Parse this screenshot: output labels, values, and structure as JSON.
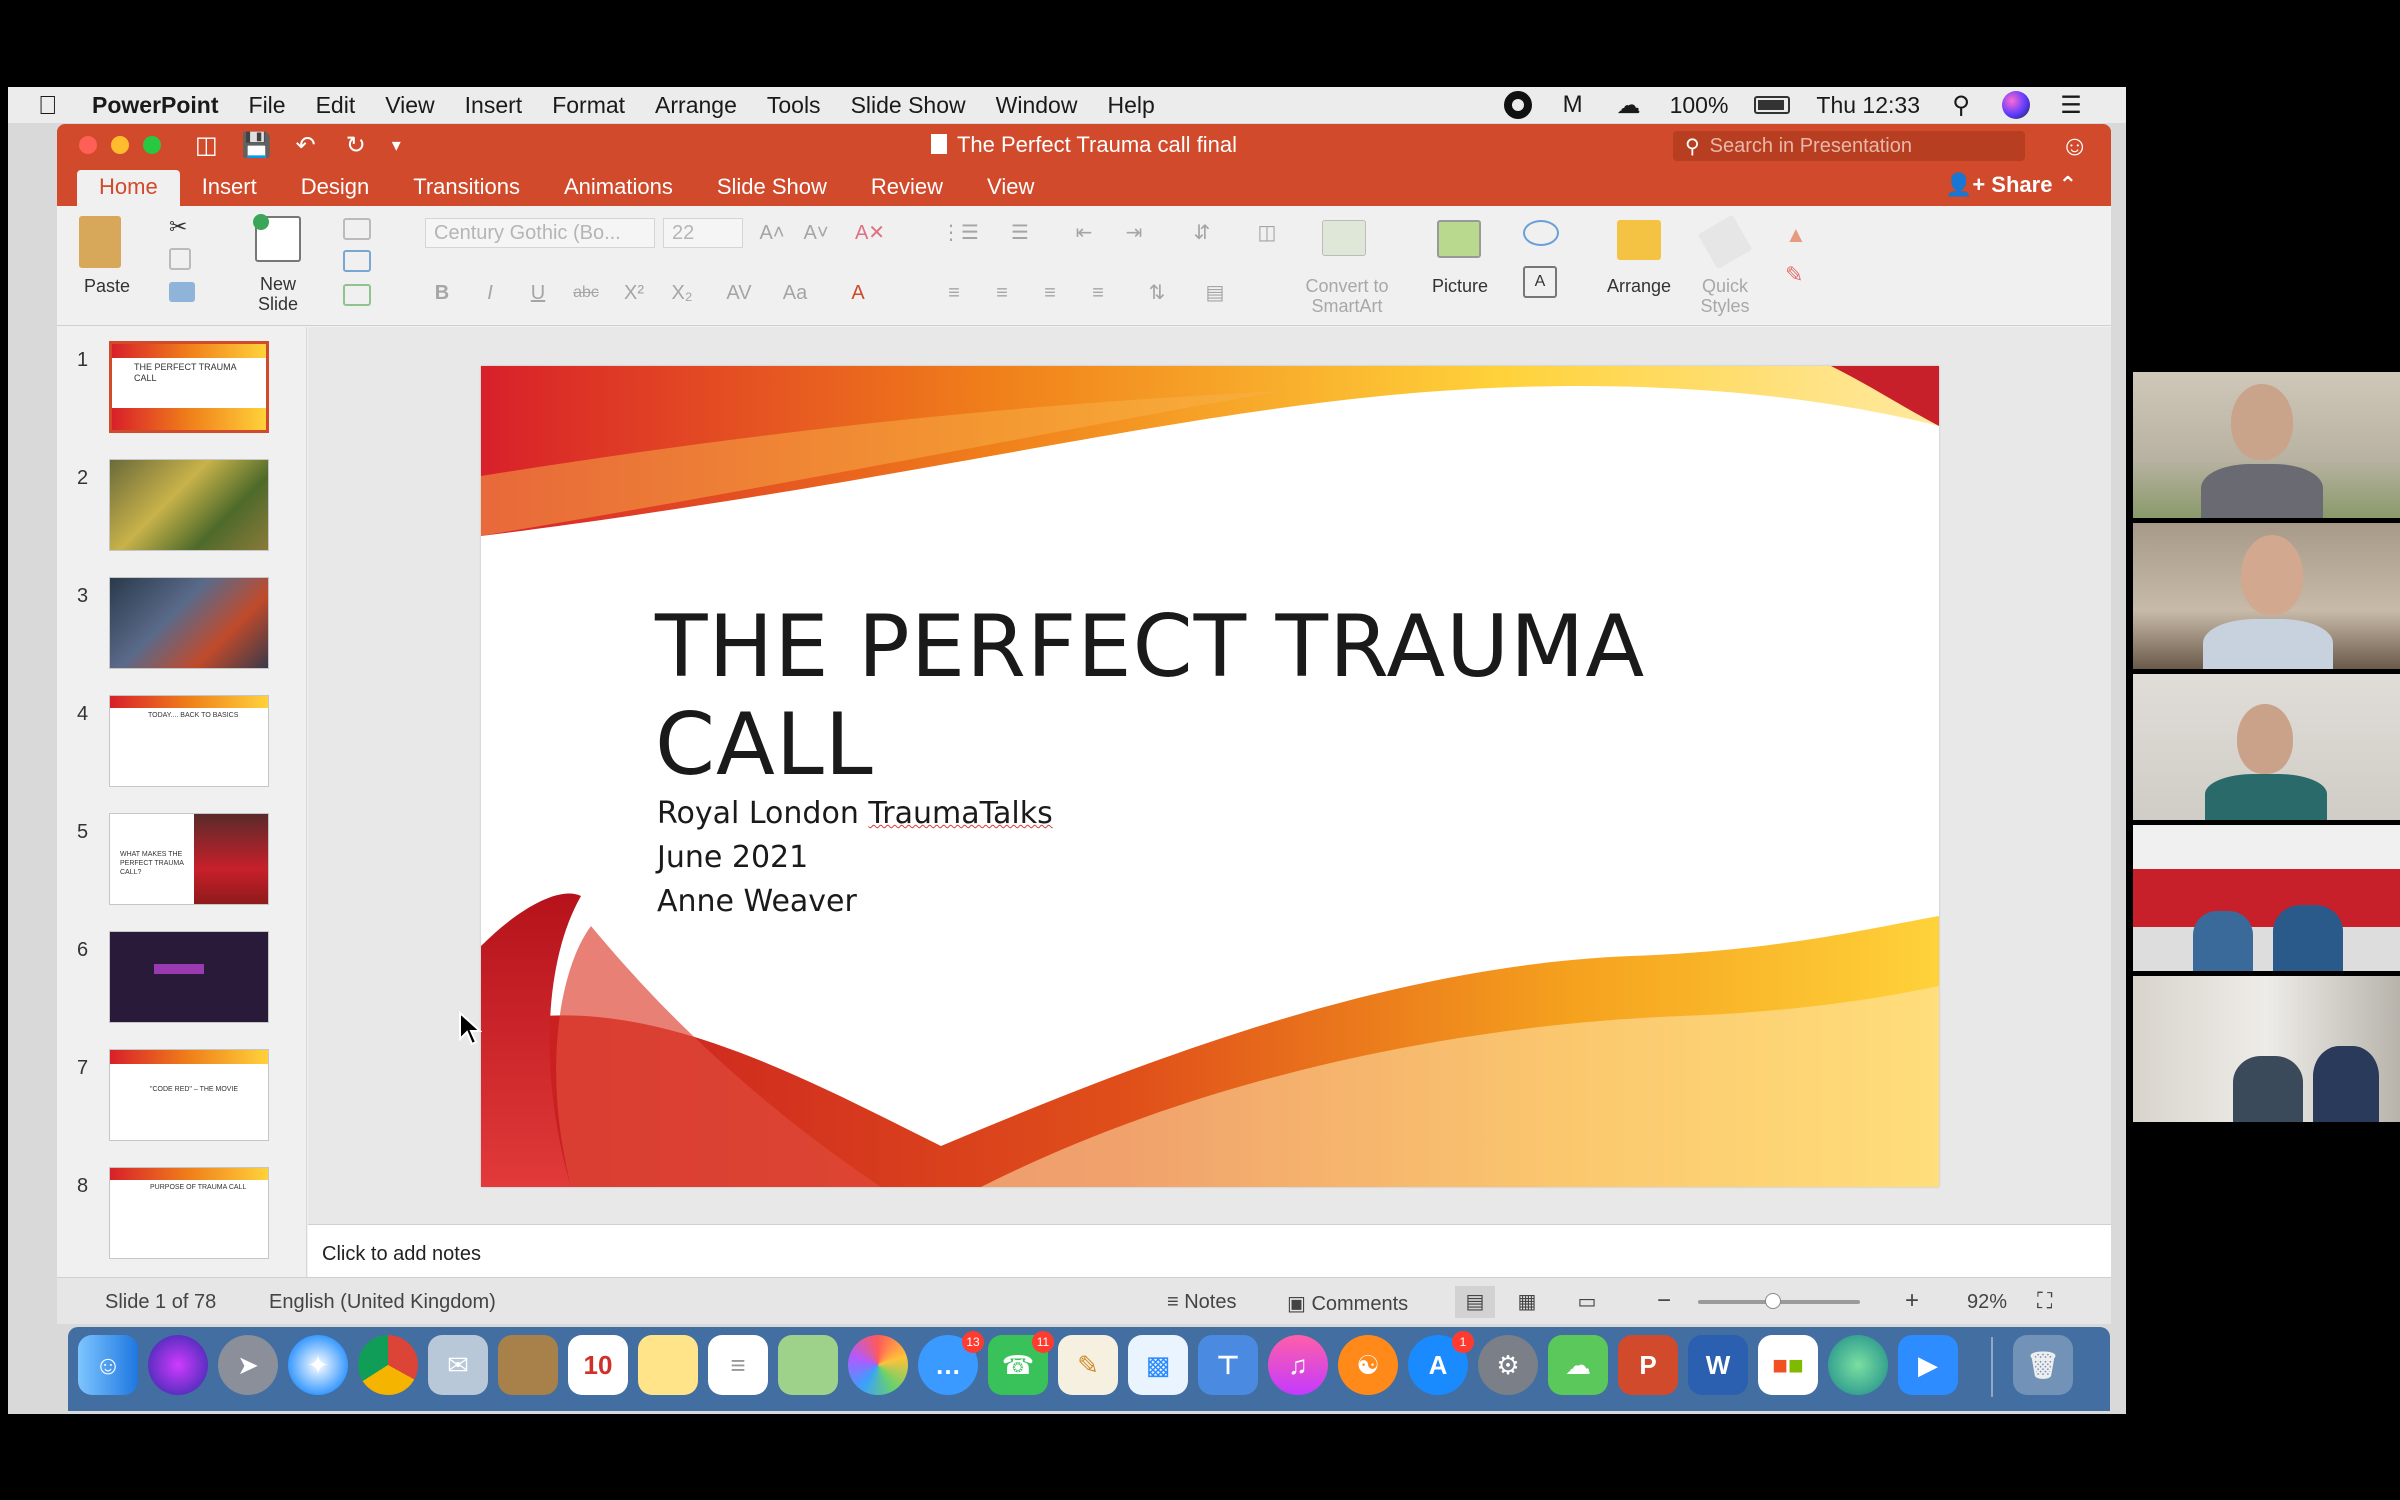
{
  "menubar": {
    "app_name": "PowerPoint",
    "items": [
      "File",
      "Edit",
      "View",
      "Insert",
      "Format",
      "Arrange",
      "Tools",
      "Slide Show",
      "Window",
      "Help"
    ],
    "battery": "100%",
    "clock": "Thu 12:33"
  },
  "window": {
    "title": "The Perfect Trauma call final",
    "search_placeholder": "Search in Presentation",
    "share_label": "Share"
  },
  "tabs": [
    "Home",
    "Insert",
    "Design",
    "Transitions",
    "Animations",
    "Slide Show",
    "Review",
    "View"
  ],
  "ribbon": {
    "paste": "Paste",
    "new_slide_1": "New",
    "new_slide_2": "Slide",
    "font_name": "Century Gothic (Bo...",
    "font_size": "22",
    "convert_1": "Convert to",
    "convert_2": "SmartArt",
    "picture": "Picture",
    "arrange": "Arrange",
    "quick_styles_1": "Quick",
    "quick_styles_2": "Styles"
  },
  "thumbnails": [
    {
      "number": "1",
      "text": "THE PERFECT TRAUMA CALL",
      "kind": "title",
      "active": true
    },
    {
      "number": "2",
      "text": "",
      "kind": "photo-yellow",
      "active": false
    },
    {
      "number": "3",
      "text": "",
      "kind": "photo-red",
      "active": false
    },
    {
      "number": "4",
      "text": "TODAY.... BACK TO BASICS",
      "kind": "text",
      "active": false
    },
    {
      "number": "5",
      "text": "WHAT MAKES THE PERFECT TRAUMA CALL?",
      "kind": "split",
      "active": false
    },
    {
      "number": "6",
      "text": "",
      "kind": "dark",
      "active": false
    },
    {
      "number": "7",
      "text": "\"CODE RED\" – THE MOVIE",
      "kind": "text",
      "active": false
    },
    {
      "number": "8",
      "text": "PURPOSE OF TRAUMA CALL",
      "kind": "text",
      "active": false
    }
  ],
  "slide": {
    "title_line_1": "THE PERFECT TRAUMA",
    "title_line_2": "CALL",
    "subtitle_prefix": "Royal London ",
    "subtitle_word": "TraumaTalks",
    "date": "June 2021",
    "author": "Anne Weaver"
  },
  "notes": {
    "placeholder": "Click to add notes"
  },
  "statusbar": {
    "slide_counter": "Slide 1 of 78",
    "language": "English (United Kingdom)",
    "notes": "Notes",
    "comments": "Comments",
    "zoom": "92%",
    "zoom_level": 0.46
  },
  "dock": {
    "badge_messages": "13",
    "badge_facetime": "11",
    "badge_appstore": "1",
    "calendar_day": "10"
  },
  "colors": {
    "accent": "#d04a2b",
    "slide_red": "#d8202a",
    "slide_orange": "#f07f1a",
    "slide_yellow": "#ffd23a"
  }
}
